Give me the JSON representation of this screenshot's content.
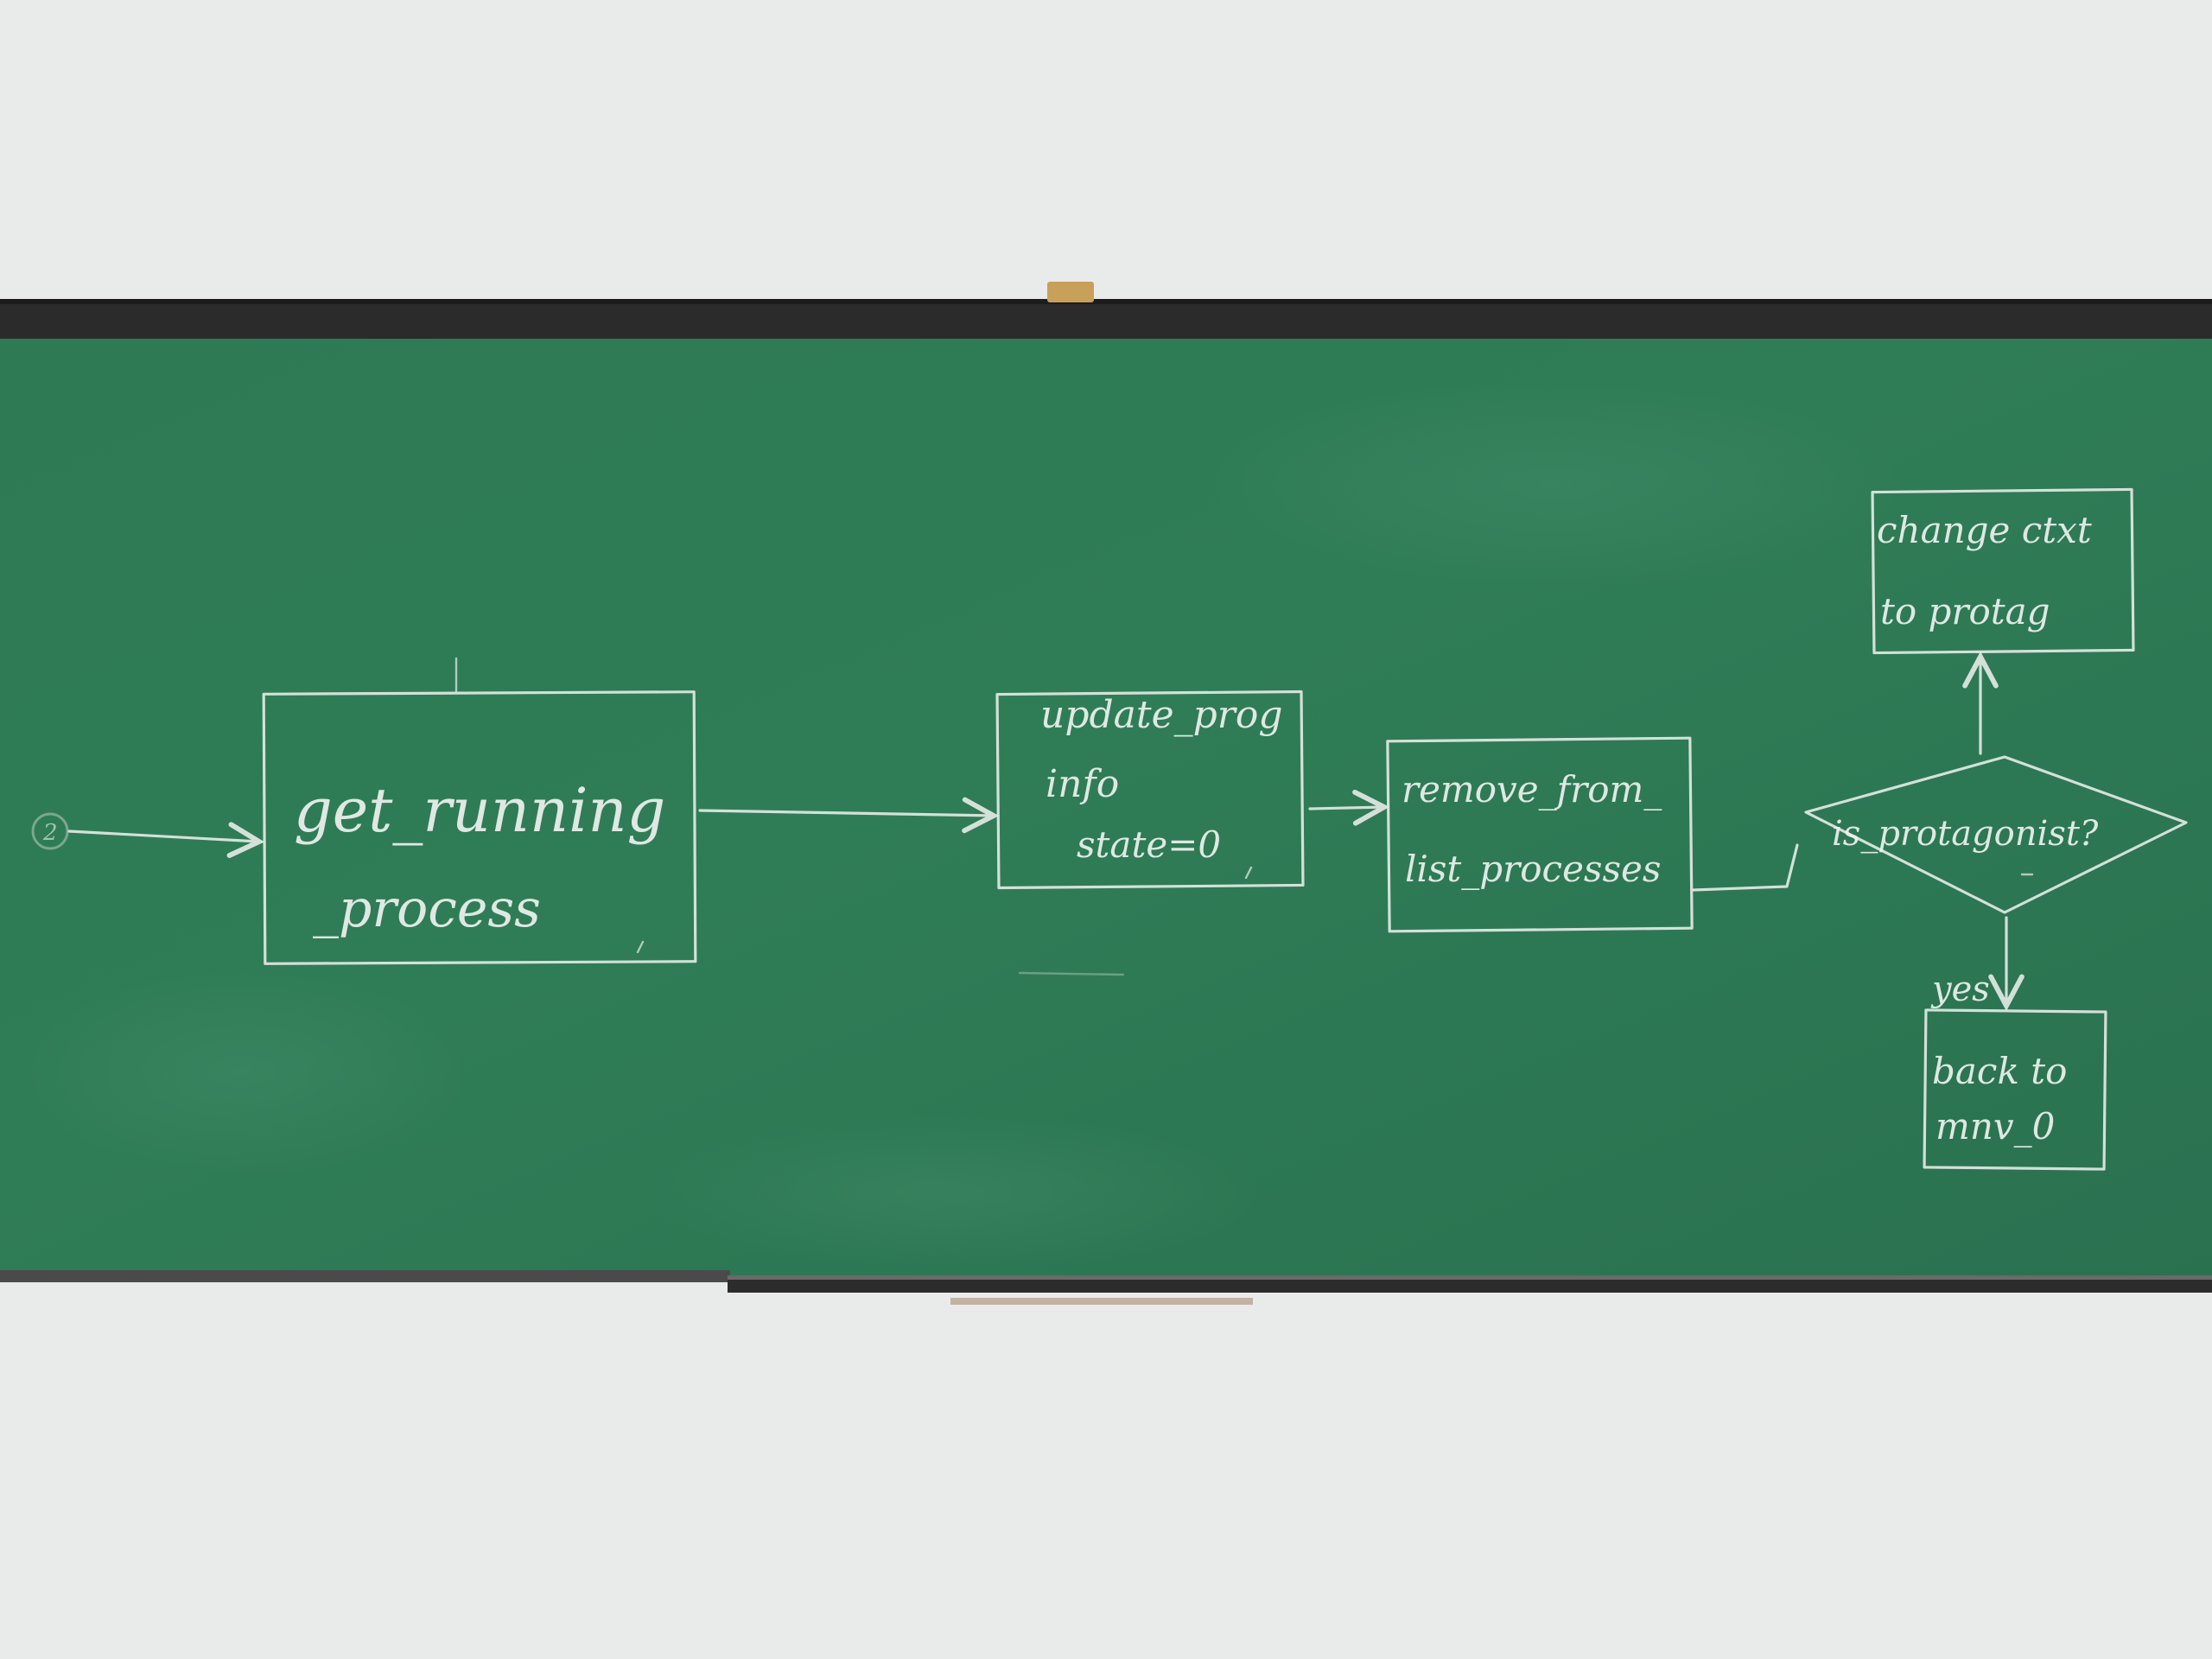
{
  "diagram": {
    "nodes": [
      {
        "id": "get_running",
        "shape": "rect",
        "lines": [
          "get_running",
          "_process"
        ]
      },
      {
        "id": "update_prog",
        "shape": "rect",
        "lines": [
          "update_prog",
          "info",
          "state=0"
        ]
      },
      {
        "id": "remove_from",
        "shape": "rect",
        "lines": [
          "remove_from_",
          "list_processes"
        ]
      },
      {
        "id": "is_protagonist",
        "shape": "diamond",
        "lines": [
          "is_protagonist?"
        ]
      },
      {
        "id": "change_ctxt",
        "shape": "rect",
        "lines": [
          "change ctxt",
          "to protag"
        ]
      },
      {
        "id": "back_to",
        "shape": "rect",
        "lines": [
          "back to",
          "mnv_0"
        ]
      }
    ],
    "edges": [
      {
        "from": "start",
        "to": "get_running",
        "label": ""
      },
      {
        "from": "get_running",
        "to": "update_prog",
        "label": ""
      },
      {
        "from": "update_prog",
        "to": "remove_from",
        "label": ""
      },
      {
        "from": "remove_from",
        "to": "is_protagonist",
        "label": ""
      },
      {
        "from": "is_protagonist",
        "to": "change_ctxt",
        "label": ""
      },
      {
        "from": "is_protagonist",
        "to": "back_to",
        "label": "yes"
      }
    ],
    "start_marker": "2"
  },
  "colors": {
    "board": "#2f7a55",
    "board_dark": "#286c4a",
    "frame": "#2a2a2a",
    "wall": "#e9ebeb",
    "chalk": "#eef2ee"
  }
}
